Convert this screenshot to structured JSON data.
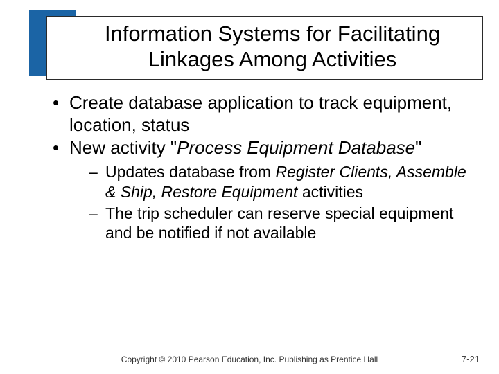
{
  "title": {
    "line1": "Information Systems for Facilitating",
    "line2": "Linkages Among Activities"
  },
  "bullets": {
    "b1": "Create database application to track equipment, location, status",
    "b2_pre": "New activity \"",
    "b2_ital": "Process Equipment Database",
    "b2_post": "\"",
    "s1_pre": "Updates database from ",
    "s1_ital": "Register Clients, Assemble & Ship, Restore Equipment",
    "s1_post": " activities",
    "s2": "The trip scheduler can reserve special equipment and be notified if not available"
  },
  "footer": {
    "copyright": "Copyright © 2010 Pearson Education, Inc. Publishing as Prentice Hall",
    "pagenum": "7-21"
  }
}
